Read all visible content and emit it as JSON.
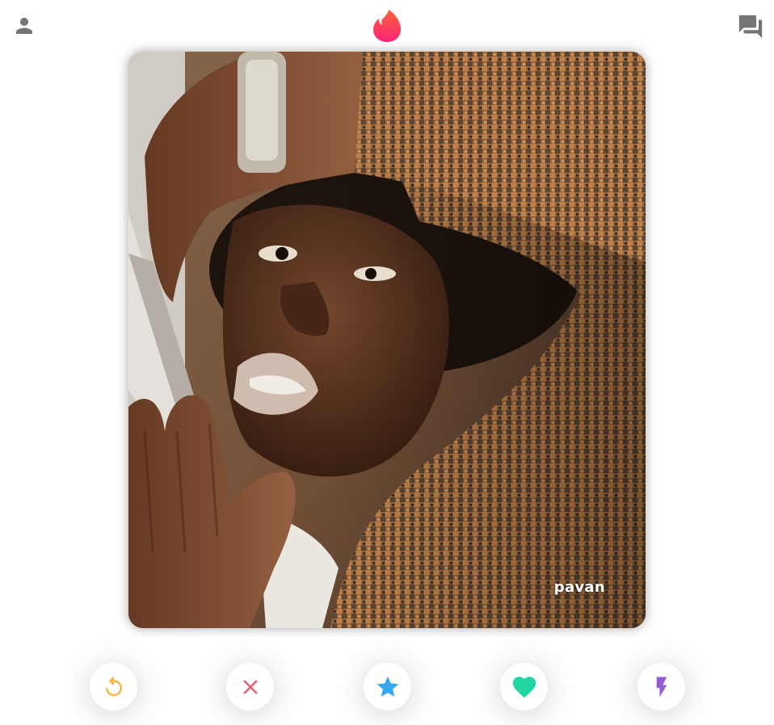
{
  "header": {
    "left_icon": "person-icon",
    "logo_icon": "flame-icon",
    "right_icon": "forum-icon",
    "logo_colors": [
      "#fd267a",
      "#ff6036"
    ],
    "icon_color": "#757575"
  },
  "card": {
    "name": "pavan"
  },
  "actions": [
    {
      "name": "rewind",
      "icon": "replay-icon",
      "color": "#f5b748"
    },
    {
      "name": "nope",
      "icon": "close-icon",
      "color": "#ec5e6f"
    },
    {
      "name": "super-like",
      "icon": "star-icon",
      "color": "#31a8f0"
    },
    {
      "name": "like",
      "icon": "heart-icon",
      "color": "#20d5a0"
    },
    {
      "name": "boost",
      "icon": "bolt-icon",
      "color": "#915dd1"
    }
  ]
}
